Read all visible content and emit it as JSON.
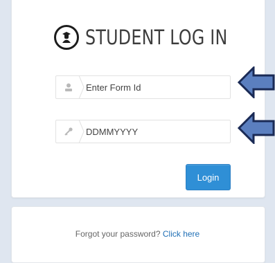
{
  "title": "STUDENT LOG IN",
  "form": {
    "form_id_placeholder": "Enter Form Id",
    "dob_placeholder": "DDMMYYYY",
    "login_label": "Login"
  },
  "forgot": {
    "text": "Forgot your password?",
    "link_label": "Click here"
  },
  "colors": {
    "button": "#2f8fd6",
    "link": "#1f6fb5",
    "arrow_fill": "#5b7fbf",
    "arrow_outline": "#1a2a55"
  },
  "icons": {
    "logo": "student-logo-icon",
    "user": "user-icon",
    "key": "key-icon",
    "pointer_arrow": "left-arrow-icon"
  }
}
